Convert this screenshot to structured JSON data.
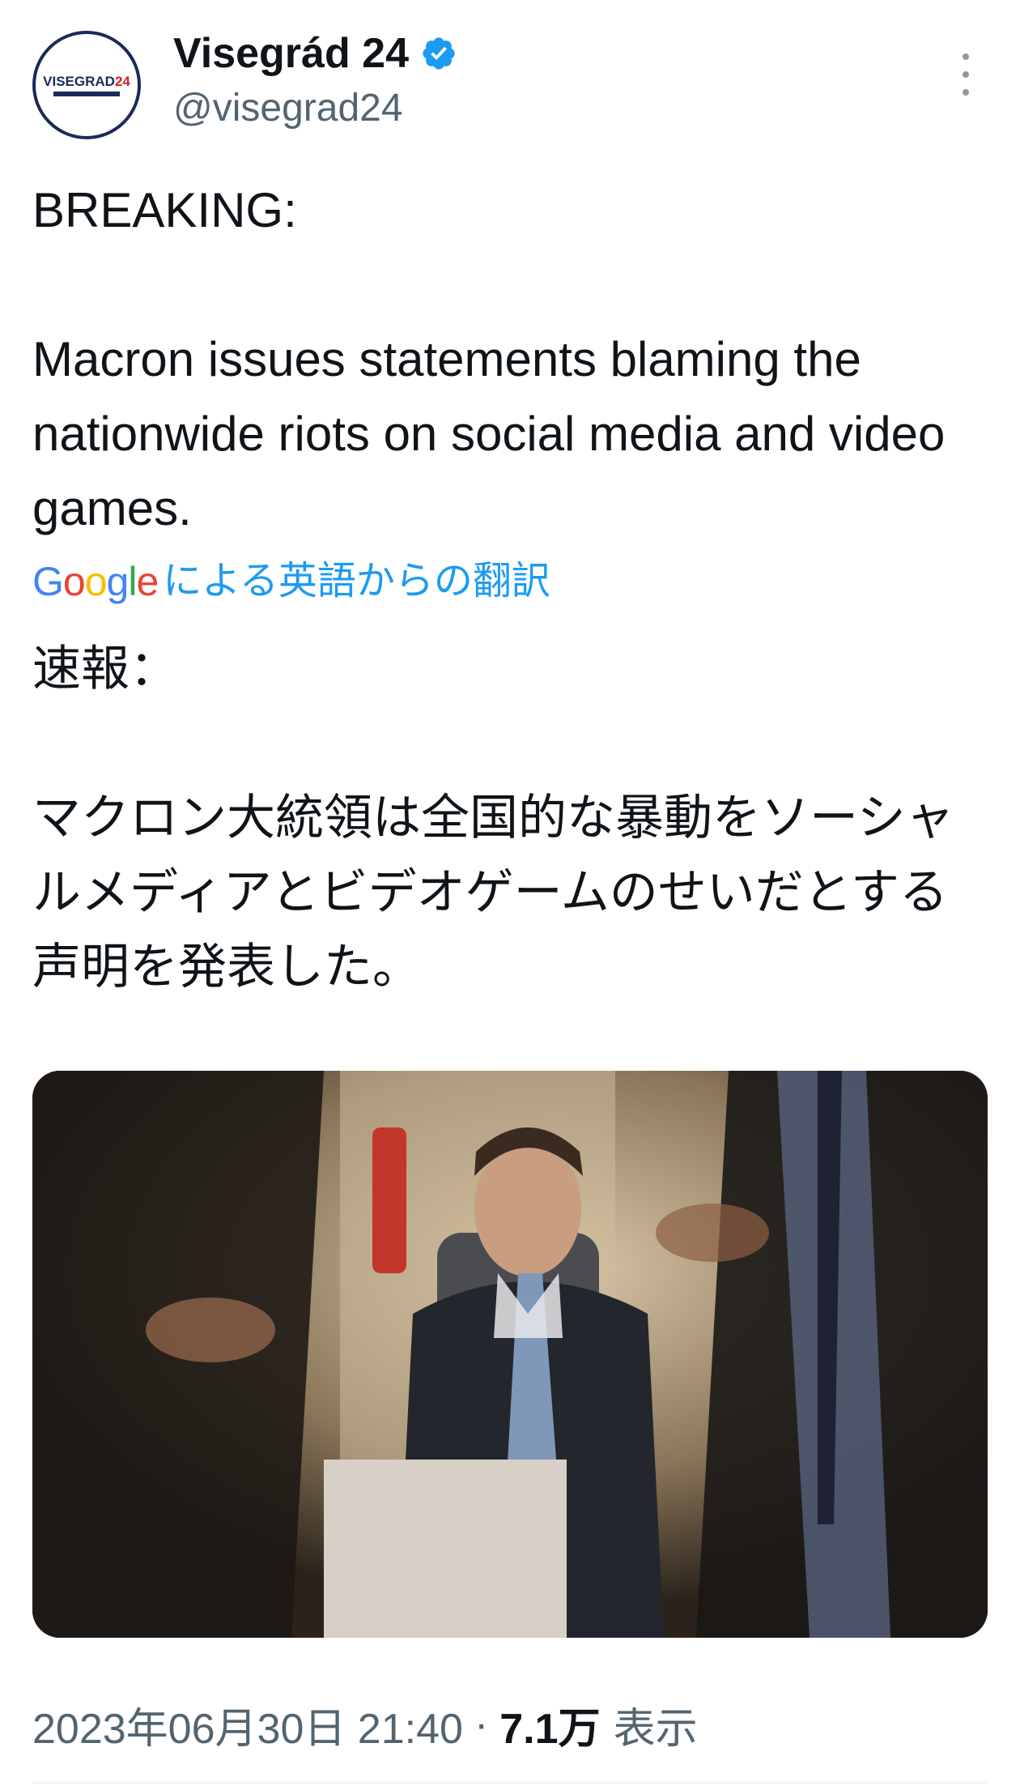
{
  "account": {
    "avatar_text": "VISEGRAD",
    "avatar_num": "24",
    "display_name": "Visegrád 24",
    "handle": "@visegrad24",
    "verified": true,
    "verified_color": "#1d9bf0"
  },
  "tweet": {
    "text": "BREAKING:\n\nMacron issues statements blaming the nationwide riots on social media and video games.",
    "translation_provider": "Google",
    "translation_label": "による英語からの翻訳",
    "translated_text": "速報：\n\nマクロン大統領は全国的な暴動をソーシャルメディアとビデオゲームのせいだとする声明を発表した。"
  },
  "meta": {
    "timestamp": "2023年06月30日 21:40",
    "separator": "·",
    "views_count": "7.1万",
    "views_label": "表示"
  },
  "colors": {
    "text": "#0f1419",
    "secondary": "#536471",
    "link": "#1d9bf0"
  },
  "icons": {
    "verified": "verified-badge-icon",
    "more": "more-vertical-icon"
  }
}
